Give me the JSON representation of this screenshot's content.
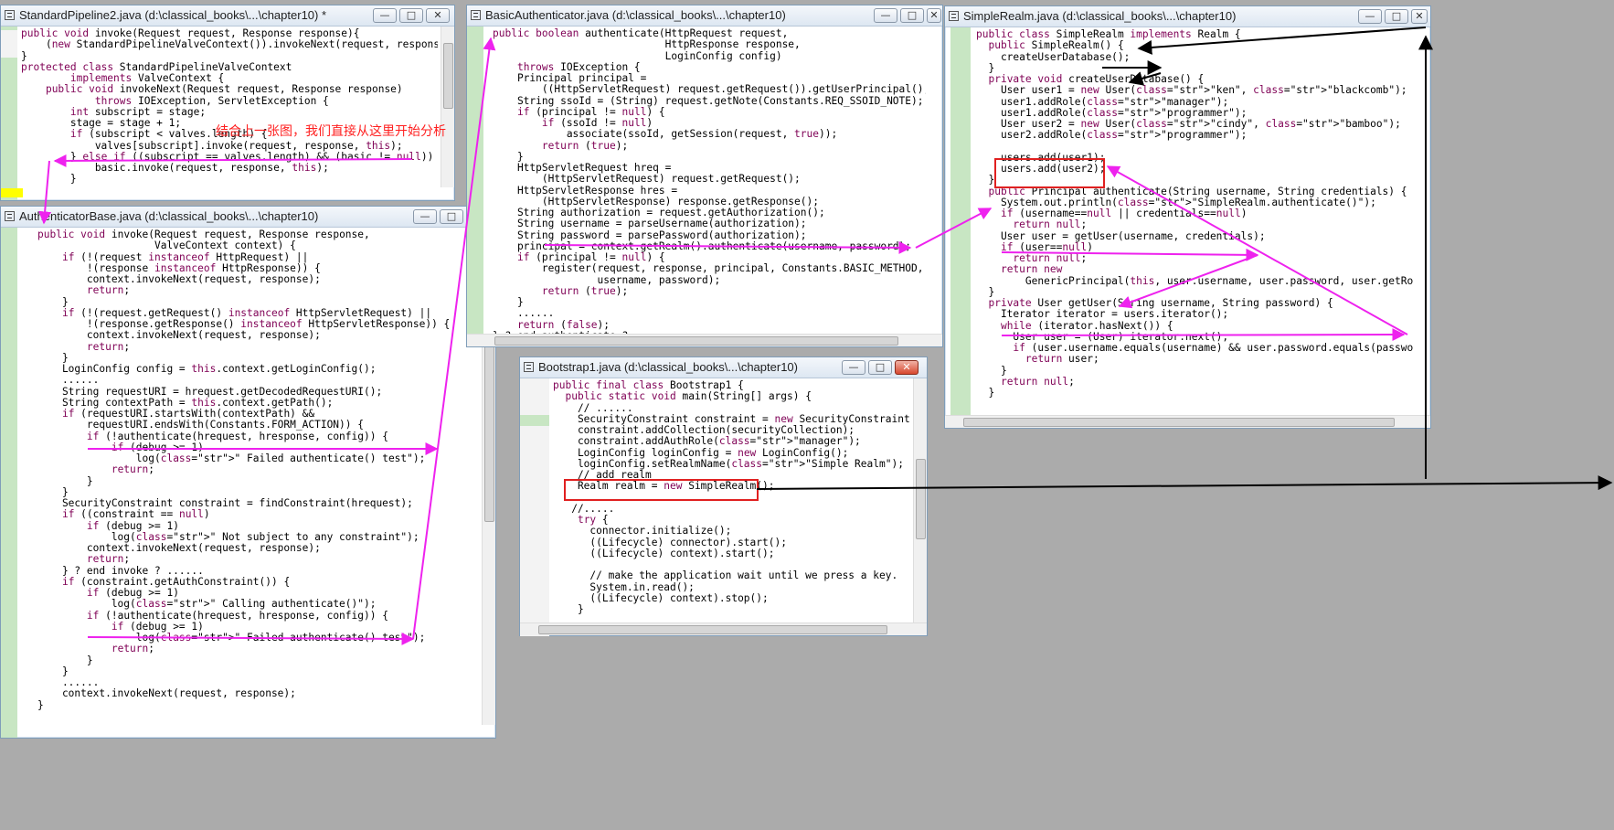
{
  "windows": [
    {
      "title": "StandardPipeline2.java (d:\\classical_books\\...\\chapter10) *",
      "lines": [
        "public void invoke(Request request, Response response){",
        "    (new StandardPipelineValveContext()).invokeNext(request, response);",
        "}",
        "protected class StandardPipelineValveContext",
        "        implements ValveContext {",
        "    public void invokeNext(Request request, Response response)",
        "            throws IOException, ServletException {",
        "        int subscript = stage;",
        "        stage = stage + 1;",
        "        if (subscript < valves.length) {",
        "            valves[subscript].invoke(request, response, this);",
        "        } else if ((subscript == valves.length) && (basic != null)) {",
        "            basic.invoke(request, response, this);",
        "        }"
      ],
      "note": "结合上一张图，我们直接从这里开始分析"
    },
    {
      "title": "AuthenticatorBase.java (d:\\classical_books\\...\\chapter10)",
      "lines": [
        "public void invoke(Request request, Response response,",
        "                   ValveContext context) {",
        "    if (!(request instanceof HttpRequest) ||",
        "        !(response instanceof HttpResponse)) {",
        "        context.invokeNext(request, response);",
        "        return;",
        "    }",
        "    if (!(request.getRequest() instanceof HttpServletRequest) ||",
        "        !(response.getResponse() instanceof HttpServletResponse)) {",
        "        context.invokeNext(request, response);",
        "        return;",
        "    }",
        "    LoginConfig config = this.context.getLoginConfig();",
        "    ......",
        "    String requestURI = hrequest.getDecodedRequestURI();",
        "    String contextPath = this.context.getPath();",
        "    if (requestURI.startsWith(contextPath) &&",
        "        requestURI.endsWith(Constants.FORM_ACTION)) {",
        "        if (!authenticate(hrequest, hresponse, config)) {",
        "            if (debug >= 1)",
        "                log(\" Failed authenticate() test\");",
        "            return;",
        "        }",
        "    }",
        "    SecurityConstraint constraint = findConstraint(hrequest);",
        "    if ((constraint == null)",
        "        if (debug >= 1)",
        "            log(\" Not subject to any constraint\");",
        "        context.invokeNext(request, response);",
        "        return;",
        "    } ? end invoke ? ......",
        "    if (constraint.getAuthConstraint()) {",
        "        if (debug >= 1)",
        "            log(\" Calling authenticate()\");",
        "        if (!authenticate(hrequest, hresponse, config)) {",
        "            if (debug >= 1)",
        "                log(\" Failed authenticate() test\");",
        "            return;",
        "        }",
        "    }",
        "    ......",
        "    context.invokeNext(request, response);",
        "}"
      ]
    },
    {
      "title": "BasicAuthenticator.java (d:\\classical_books\\...\\chapter10)",
      "lines": [
        "public boolean authenticate(HttpRequest request,",
        "                            HttpResponse response,",
        "                            LoginConfig config)",
        "    throws IOException {",
        "    Principal principal =",
        "        ((HttpServletRequest) request.getRequest()).getUserPrincipal();",
        "    String ssoId = (String) request.getNote(Constants.REQ_SSOID_NOTE);",
        "    if (principal != null) {",
        "        if (ssoId != null)",
        "            associate(ssoId, getSession(request, true));",
        "        return (true);",
        "    }",
        "    HttpServletRequest hreq =",
        "        (HttpServletRequest) request.getRequest();",
        "    HttpServletResponse hres =",
        "        (HttpServletResponse) response.getResponse();",
        "    String authorization = request.getAuthorization();",
        "    String username = parseUsername(authorization);",
        "    String password = parsePassword(authorization);",
        "    principal = context.getRealm().authenticate(username, password);",
        "    if (principal != null) {",
        "        register(request, response, principal, Constants.BASIC_METHOD,",
        "                 username, password);",
        "        return (true);",
        "    }",
        "    ......",
        "    return (false);",
        "} ? end authenticate ?"
      ]
    },
    {
      "title": "SimpleRealm.java (d:\\classical_books\\...\\chapter10)",
      "lines": [
        "public class SimpleRealm implements Realm {",
        "  public SimpleRealm() {",
        "    createUserDatabase();",
        "  }",
        "  private void createUserDatabase() {",
        "    User user1 = new User(\"ken\", \"blackcomb\");",
        "    user1.addRole(\"manager\");",
        "    user1.addRole(\"programmer\");",
        "    User user2 = new User(\"cindy\", \"bamboo\");",
        "    user2.addRole(\"programmer\");",
        "",
        "    users.add(user1);",
        "    users.add(user2);",
        "  }",
        "  public Principal authenticate(String username, String credentials) {",
        "    System.out.println(\"SimpleRealm.authenticate()\");",
        "    if (username==null || credentials==null)",
        "      return null;",
        "    User user = getUser(username, credentials);",
        "    if (user==null)",
        "      return null;",
        "    return new",
        "        GenericPrincipal(this, user.username, user.password, user.getRoles());",
        "  }",
        "  private User getUser(String username, String password) {",
        "    Iterator iterator = users.iterator();",
        "    while (iterator.hasNext()) {",
        "      User user = (User) iterator.next();",
        "      if (user.username.equals(username) && user.password.equals(password))",
        "        return user;",
        "    }",
        "    return null;",
        "  }"
      ]
    },
    {
      "title": "Bootstrap1.java (d:\\classical_books\\...\\chapter10)",
      "lines": [
        "public final class Bootstrap1 {",
        "  public static void main(String[] args) {",
        "    // ......",
        "    SecurityConstraint constraint = new SecurityConstraint();",
        "    constraint.addCollection(securityCollection);",
        "    constraint.addAuthRole(\"manager\");",
        "    LoginConfig loginConfig = new LoginConfig();",
        "    loginConfig.setRealmName(\"Simple Realm\");",
        "    // add realm",
        "    Realm realm = new SimpleRealm();",
        "",
        "   //.....",
        "    try {",
        "      connector.initialize();",
        "      ((Lifecycle) connector).start();",
        "      ((Lifecycle) context).start();",
        "",
        "      // make the application wait until we press a key.",
        "      System.in.read();",
        "      ((Lifecycle) context).stop();",
        "    }"
      ]
    }
  ],
  "window_buttons": {
    "minimize": "—",
    "maximize": "□",
    "close": "✕"
  },
  "colors": {
    "arrow_magenta": "#ee22ee",
    "arrow_black": "#000000",
    "redbox": "#e02020"
  }
}
